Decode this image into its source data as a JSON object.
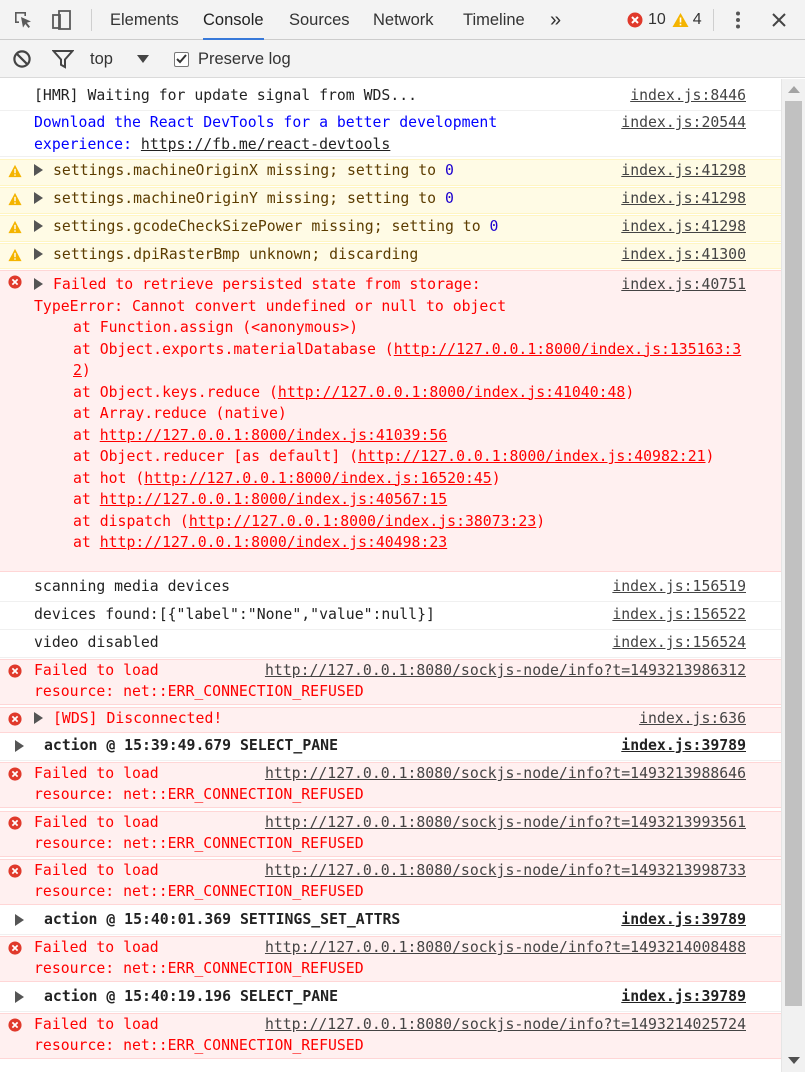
{
  "tabs": {
    "elements": "Elements",
    "console": "Console",
    "sources": "Sources",
    "network": "Network",
    "timeline": "Timeline",
    "more": "»"
  },
  "counts": {
    "errors": "10",
    "warnings": "4"
  },
  "toolbar": {
    "context": "top",
    "preserve_log": "Preserve log",
    "preserve_log_checked": true
  },
  "colors": {
    "accent": "#3879d9",
    "error": "#ff0000",
    "error_bg": "#fff0f0",
    "warn_bg": "#fffbe5",
    "info": "#0000ff"
  },
  "rows": {
    "r1": {
      "msg": "[HMR] Waiting for update signal from WDS...",
      "src": "index.js:8446"
    },
    "r2": {
      "msg": "Download the React DevTools for a better development experience: ",
      "link": "https://fb.me/react-devtools",
      "src": "index.js:20544"
    },
    "r3": {
      "msg": "settings.machineOriginX missing; setting to ",
      "num": "0",
      "src": "index.js:41298"
    },
    "r4": {
      "msg": "settings.machineOriginY missing; setting to ",
      "num": "0",
      "src": "index.js:41298"
    },
    "r5": {
      "msg": "settings.gcodeCheckSizePower missing; setting to ",
      "num": "0",
      "src": "index.js:41298"
    },
    "r6": {
      "msg": "settings.dpiRasterBmp unknown; discarding",
      "src": "index.js:41300"
    },
    "r7": {
      "line1": "Failed to retrieve persisted state from storage:",
      "line2": "TypeError: Cannot convert undefined or null to object",
      "s1": "at Function.assign (<anonymous>)",
      "s2_pre": "at Object.exports.materialDatabase (",
      "s2_link": "http://127.0.0.1:8000/index.js:135163:32",
      "s2_post": ")",
      "s3_pre": "at Object.keys.reduce (",
      "s3_link": "http://127.0.0.1:8000/index.js:41040:48",
      "s3_post": ")",
      "s4": "at Array.reduce (native)",
      "s5_pre": "at ",
      "s5_link": "http://127.0.0.1:8000/index.js:41039:56",
      "s6_pre": "at Object.reducer [as default] (",
      "s6_link": "http://127.0.0.1:8000/index.js:40982:21",
      "s6_post": ")",
      "s7_pre": "at hot (",
      "s7_link": "http://127.0.0.1:8000/index.js:16520:45",
      "s7_post": ")",
      "s8_pre": "at ",
      "s8_link": "http://127.0.0.1:8000/index.js:40567:15",
      "s9_pre": "at dispatch (",
      "s9_link": "http://127.0.0.1:8000/index.js:38073:23",
      "s9_post": ")",
      "s10_pre": "at ",
      "s10_link": "http://127.0.0.1:8000/index.js:40498:23",
      "src": "index.js:40751"
    },
    "r8": {
      "msg": "scanning media devices",
      "src": "index.js:156519"
    },
    "r9": {
      "msg": "devices found:[{\"label\":\"None\",\"value\":null}]",
      "src": "index.js:156522"
    },
    "r10": {
      "msg": "video disabled",
      "src": "index.js:156524"
    },
    "r11": {
      "msg": "Failed to load",
      "url": "http://127.0.0.1:8080/sockjs-node/info?t=1493213986312",
      "line2": "resource: net::ERR_CONNECTION_REFUSED"
    },
    "r12": {
      "msg": "[WDS] Disconnected!",
      "src": "index.js:636"
    },
    "r13": {
      "msg": "action @ 15:39:49.679 SELECT_PANE",
      "src": "index.js:39789"
    },
    "r14": {
      "msg": "Failed to load",
      "url": "http://127.0.0.1:8080/sockjs-node/info?t=1493213988646",
      "line2": "resource: net::ERR_CONNECTION_REFUSED"
    },
    "r15": {
      "msg": "Failed to load",
      "url": "http://127.0.0.1:8080/sockjs-node/info?t=1493213993561",
      "line2": "resource: net::ERR_CONNECTION_REFUSED"
    },
    "r16": {
      "msg": "Failed to load",
      "url": "http://127.0.0.1:8080/sockjs-node/info?t=1493213998733",
      "line2": "resource: net::ERR_CONNECTION_REFUSED"
    },
    "r17": {
      "msg": "action @ 15:40:01.369 SETTINGS_SET_ATTRS",
      "src": "index.js:39789"
    },
    "r18": {
      "msg": "Failed to load",
      "url": "http://127.0.0.1:8080/sockjs-node/info?t=1493214008488",
      "line2": "resource: net::ERR_CONNECTION_REFUSED"
    },
    "r19": {
      "msg": "action @ 15:40:19.196 SELECT_PANE",
      "src": "index.js:39789"
    },
    "r20": {
      "msg": "Failed to load",
      "url": "http://127.0.0.1:8080/sockjs-node/info?t=1493214025724",
      "line2": "resource: net::ERR_CONNECTION_REFUSED"
    }
  }
}
